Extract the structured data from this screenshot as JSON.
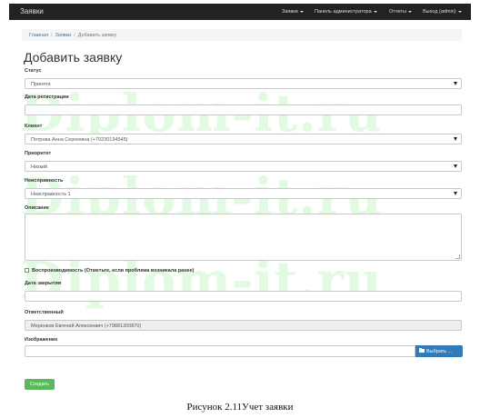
{
  "navbar": {
    "brand": "Заявки",
    "items": [
      {
        "label": "Заявки"
      },
      {
        "label": "Панель администратора"
      },
      {
        "label": "Отчеты"
      },
      {
        "label": "Выход (admin)"
      }
    ]
  },
  "breadcrumb": {
    "home": "Главная",
    "section": "Заявки",
    "current": "Добавить заявку"
  },
  "page": {
    "title": "Добавить заявку"
  },
  "form": {
    "status": {
      "label": "Статус",
      "value": "Принята"
    },
    "registration_date": {
      "label": "Дата регистрации",
      "value": ""
    },
    "client": {
      "label": "Клиент",
      "value": "Потрова Анна Сергеевна (+79230134545)"
    },
    "priority": {
      "label": "Приоритет",
      "value": "Низкий"
    },
    "fault": {
      "label": "Неисправность",
      "value": "Неисправность 1"
    },
    "description": {
      "label": "Описание",
      "value": ""
    },
    "reproducibility": {
      "label": "Воспроизводимость (Отметьте, если проблема возникала ранее)",
      "checked": false
    },
    "close_date": {
      "label": "Дата закрытия",
      "value": ""
    },
    "responsible": {
      "label": "Ответственный",
      "value": "Мерeнков Евгений Алексеевич (+79881300870)"
    },
    "image": {
      "label": "Изображение",
      "button_label": "Выбрать ..."
    },
    "submit_label": "Создать"
  },
  "watermark": {
    "text": "Diplom-it.ru"
  },
  "caption": {
    "text": "Рисунок 2.11Учет заявки"
  },
  "icons": {
    "file_button": "folder-open-icon"
  },
  "colors": {
    "navbar_bg": "#222222",
    "link": "#337ab7",
    "primary_button": "#337ab7",
    "success_button": "#5cb85c",
    "watermark": "#78e678"
  }
}
